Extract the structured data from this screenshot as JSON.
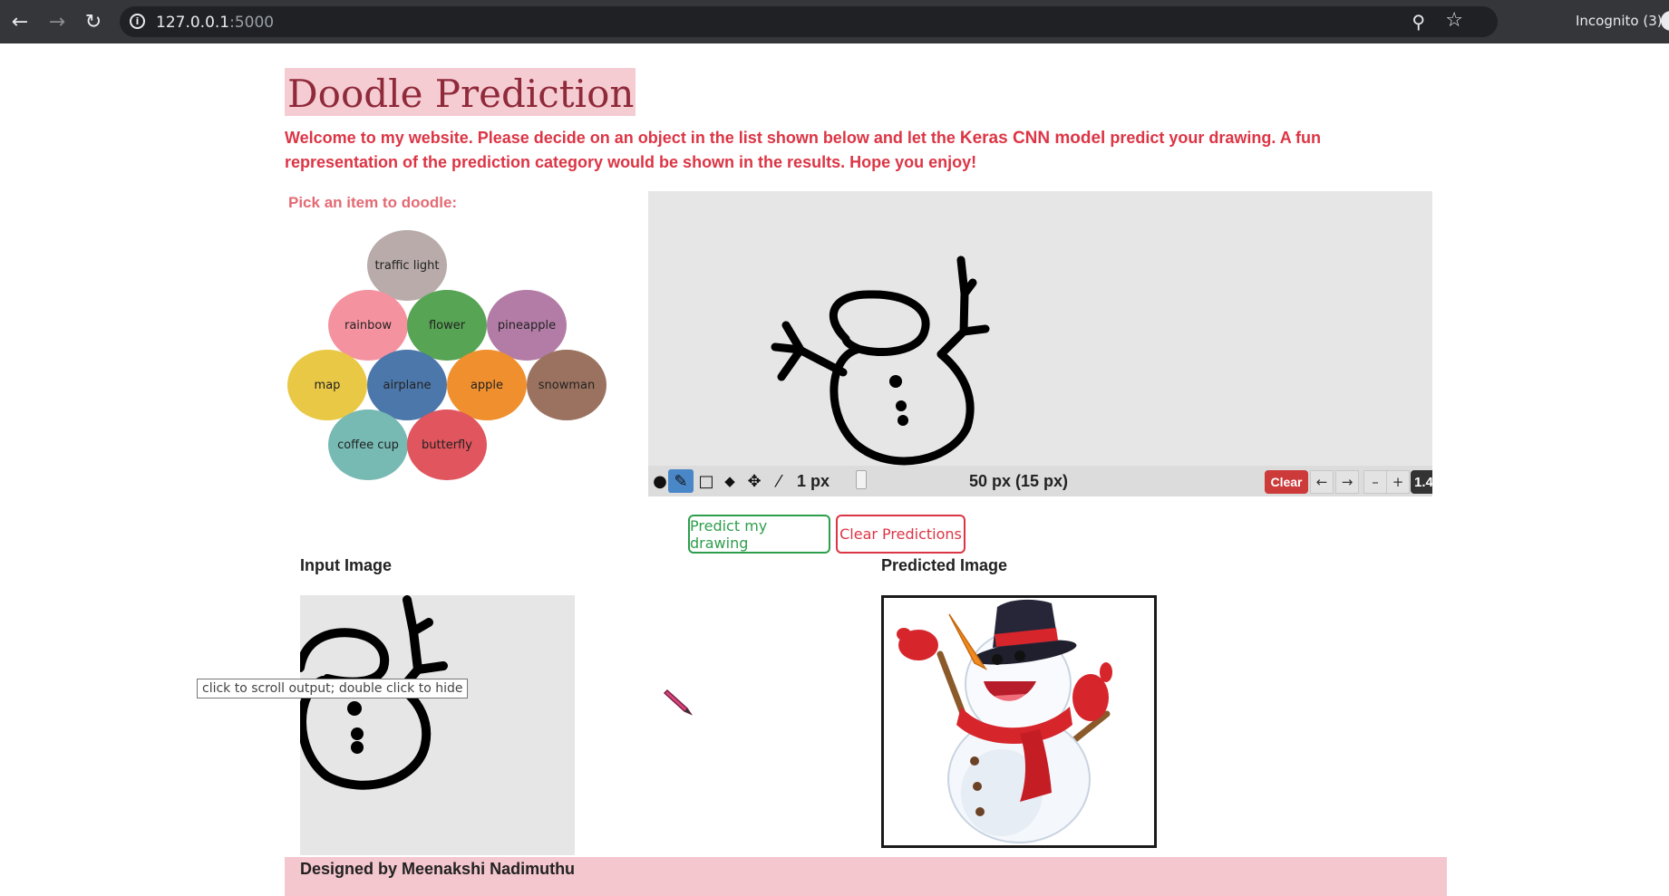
{
  "browser": {
    "url_host": "127.0.0.1",
    "url_port": ":5000",
    "profile_label": "Incognito (3)",
    "icons": [
      "back-arrow-icon",
      "forward-arrow-icon",
      "reload-icon",
      "info-icon",
      "zoom-icon",
      "star-icon"
    ]
  },
  "page": {
    "title": "Doodle Prediction",
    "intro_part1": "Welcome to my website. Please decide on an object in the list shown below and let the ",
    "intro_bold": "Keras CNN model",
    "intro_part2": " predict your drawing. A fun representation of the prediction category would be shown in the results. Hope you enjoy!",
    "pick_label": "Pick an item to doodle:"
  },
  "categories": [
    {
      "label": "traffic light",
      "color": "#b8aba9"
    },
    {
      "label": "rainbow",
      "color": "#f5929f"
    },
    {
      "label": "flower",
      "color": "#57a454"
    },
    {
      "label": "pineapple",
      "color": "#b27ca6"
    },
    {
      "label": "map",
      "color": "#e9c845"
    },
    {
      "label": "airplane",
      "color": "#4c77aa"
    },
    {
      "label": "apple",
      "color": "#f08f2e"
    },
    {
      "label": "snowman",
      "color": "#9b725f"
    },
    {
      "label": "coffee cup",
      "color": "#77b9b3"
    },
    {
      "label": "butterfly",
      "color": "#e0555e"
    }
  ],
  "toolbar": {
    "brush_size": "1 px",
    "canvas_size": "50 px (15 px)",
    "clear_label": "Clear",
    "undo_label": "←",
    "redo_label": "→",
    "zoom_out_label": "–",
    "zoom_in_label": "+",
    "zoom_value": "1.4",
    "active_tool": "pencil"
  },
  "buttons": {
    "predict_label": "Predict my drawing",
    "clear_predictions_label": "Clear Predictions"
  },
  "results": {
    "input_label": "Input Image",
    "predicted_label": "Predicted Image",
    "tooltip": "click to scroll output; double click to hide"
  },
  "footer": {
    "text": "Designed by Meenakshi Nadimuthu"
  },
  "colors": {
    "accent_red": "#dc3545",
    "title_bg": "#f6ccd3",
    "footer_bg": "#f4c6ce",
    "predict_green": "#2e9e4c"
  }
}
